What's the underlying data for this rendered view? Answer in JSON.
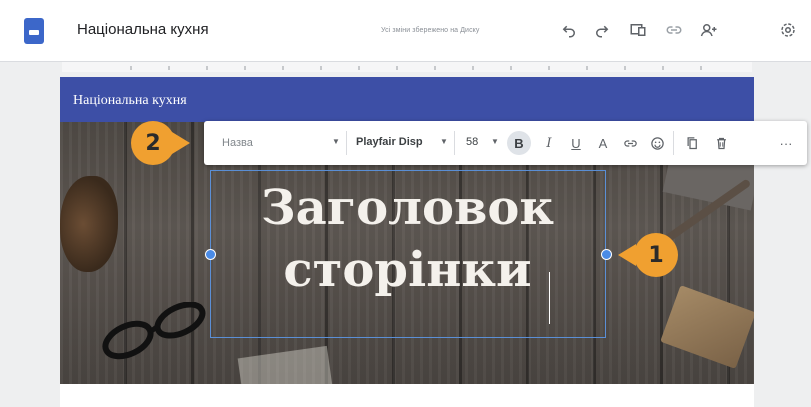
{
  "topbar": {
    "doc_title": "Національна кухня",
    "save_status": "Усі зміни збережено на Диску",
    "icons": [
      "undo-icon",
      "redo-icon",
      "preview-icon",
      "link-icon",
      "share-icon",
      "settings-icon"
    ]
  },
  "page": {
    "site_title": "Національна кухня",
    "hero_title_line1": "Заголовок",
    "hero_title_line2": "сторінки"
  },
  "text_toolbar": {
    "style": "Назва",
    "font": "Playfair Disp",
    "size": "58",
    "bold_label": "B",
    "italic_label": "I",
    "underline_label": "U",
    "color_label": "A",
    "more_label": "···"
  },
  "callouts": {
    "one": "1",
    "two": "2"
  },
  "colors": {
    "header_blue": "#3d4fa6",
    "callout_orange": "#f0a030",
    "selection_blue": "#4a8be6"
  }
}
